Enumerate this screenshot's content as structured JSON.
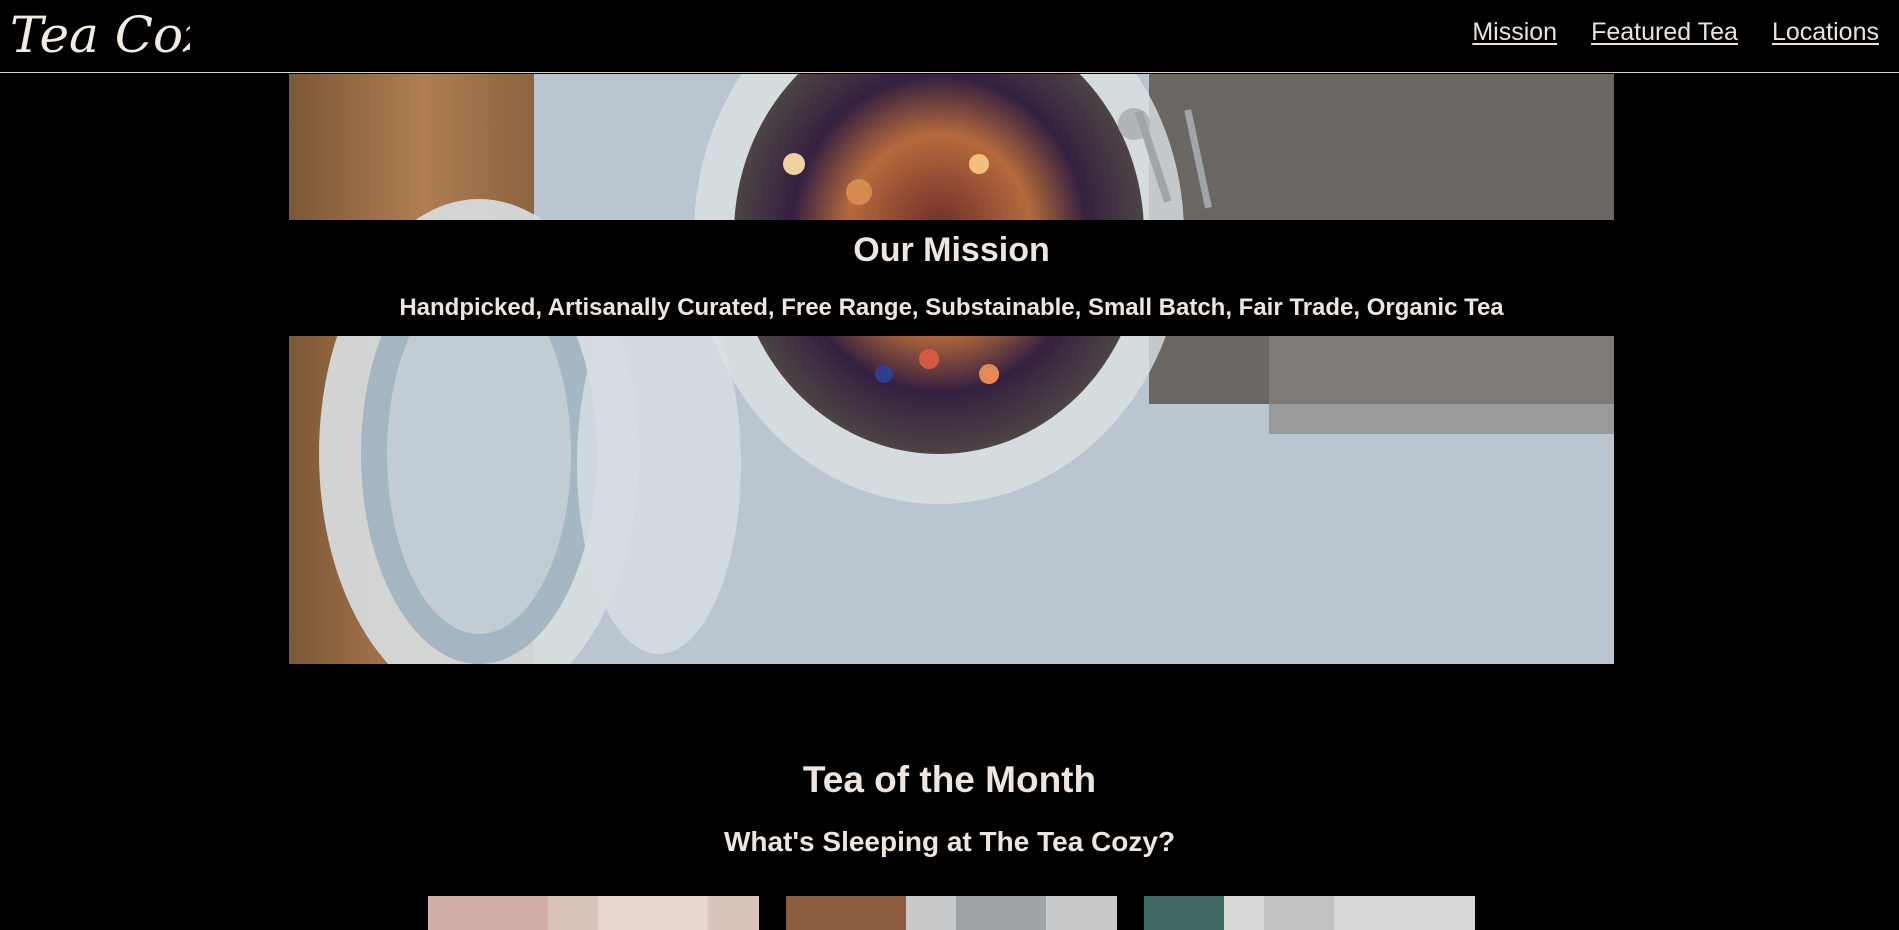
{
  "header": {
    "logo_text": "Tea Cozy",
    "nav": [
      {
        "label": "Mission"
      },
      {
        "label": "Featured Tea"
      },
      {
        "label": "Locations"
      }
    ]
  },
  "mission": {
    "title": "Our Mission",
    "subtitle": "Handpicked, Artisanally Curated, Free Range, Substainable, Small Batch, Fair Trade, Organic Tea"
  },
  "tea_of_month": {
    "title": "Tea of the Month",
    "subtitle": "What's Sleeping at The Tea Cozy?"
  },
  "colors": {
    "background": "#000000",
    "text": "#eee6de",
    "header_border": "#d9d2cc"
  }
}
